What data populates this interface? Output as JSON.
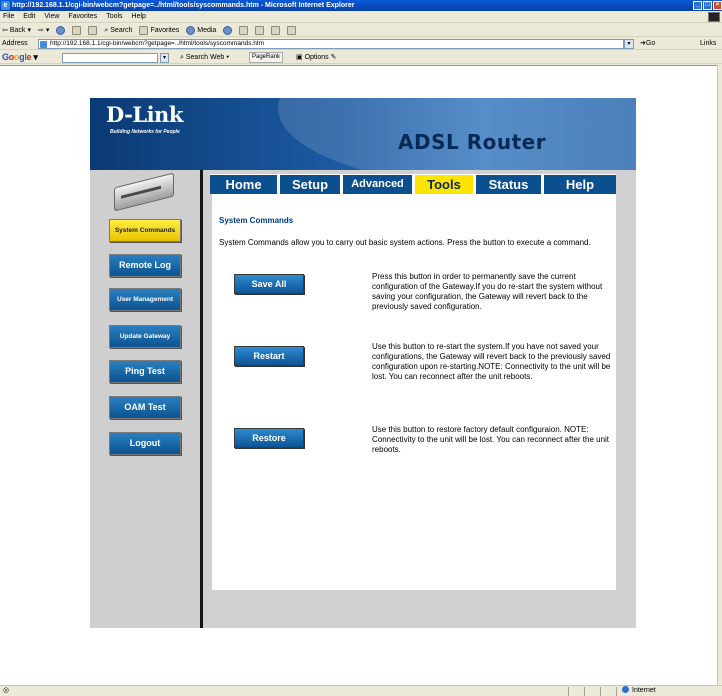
{
  "window": {
    "title": "http://192.168.1.1/cgi-bin/webcm?getpage=../html/tools/syscommands.htm - Microsoft Internet Explorer"
  },
  "menu": [
    "File",
    "Edit",
    "View",
    "Favorites",
    "Tools",
    "Help"
  ],
  "toolbar": {
    "back": "Back",
    "search": "Search",
    "favorites": "Favorites",
    "media": "Media"
  },
  "address": {
    "label": "Address",
    "url": "http://192.168.1.1/cgi-bin/webcm?getpage=../html/tools/syscommands.htm",
    "go": "Go",
    "links": "Links"
  },
  "google_bar": {
    "logo": [
      "G",
      "o",
      "o",
      "g",
      "l",
      "e"
    ],
    "search_web": "Search Web",
    "pagerank": "PageRank",
    "options": "Options"
  },
  "router": {
    "brand": "D-Link",
    "tagline": "Building Networks for People",
    "product": "ADSL Router"
  },
  "tabs": [
    "Home",
    "Setup",
    "Advanced",
    "Tools",
    "Status",
    "Help"
  ],
  "active_tab": "Tools",
  "sidebar": [
    {
      "label": "System Commands",
      "active": true
    },
    {
      "label": "Remote Log",
      "active": false
    },
    {
      "label": "User Management",
      "active": false
    },
    {
      "label": "Update Gateway",
      "active": false
    },
    {
      "label": "Ping Test",
      "active": false
    },
    {
      "label": "OAM Test",
      "active": false
    },
    {
      "label": "Logout",
      "active": false
    }
  ],
  "content": {
    "title": "System Commands",
    "intro": "System Commands allow you to carry out basic system actions. Press the button to execute a command.",
    "commands": [
      {
        "button": "Save All",
        "description": "Press this button in order to permanently save the current configuration of the Gateway.If you do re-start the system without saving your configuration, the Gateway will revert back to the previously saved configuration."
      },
      {
        "button": "Restart",
        "description": "Use this button to re-start the system.If you have not saved your configurations, the Gateway will revert back to the previously saved configuration upon re-starting.NOTE: Connectivity to the unit will be lost. You can reconnect after the unit reboots."
      },
      {
        "button": "Restore",
        "description": "Use this button to restore factory default configuraion. NOTE: Connectivity to the unit will be lost. You can reconnect after the unit reboots."
      }
    ]
  },
  "status": {
    "zone": "Internet"
  },
  "colors": {
    "header_blue": "#1d5aa2",
    "tab_bar": "#0b4f8e",
    "active_yellow": "#ffe400",
    "title_blue": "#003a8c"
  }
}
